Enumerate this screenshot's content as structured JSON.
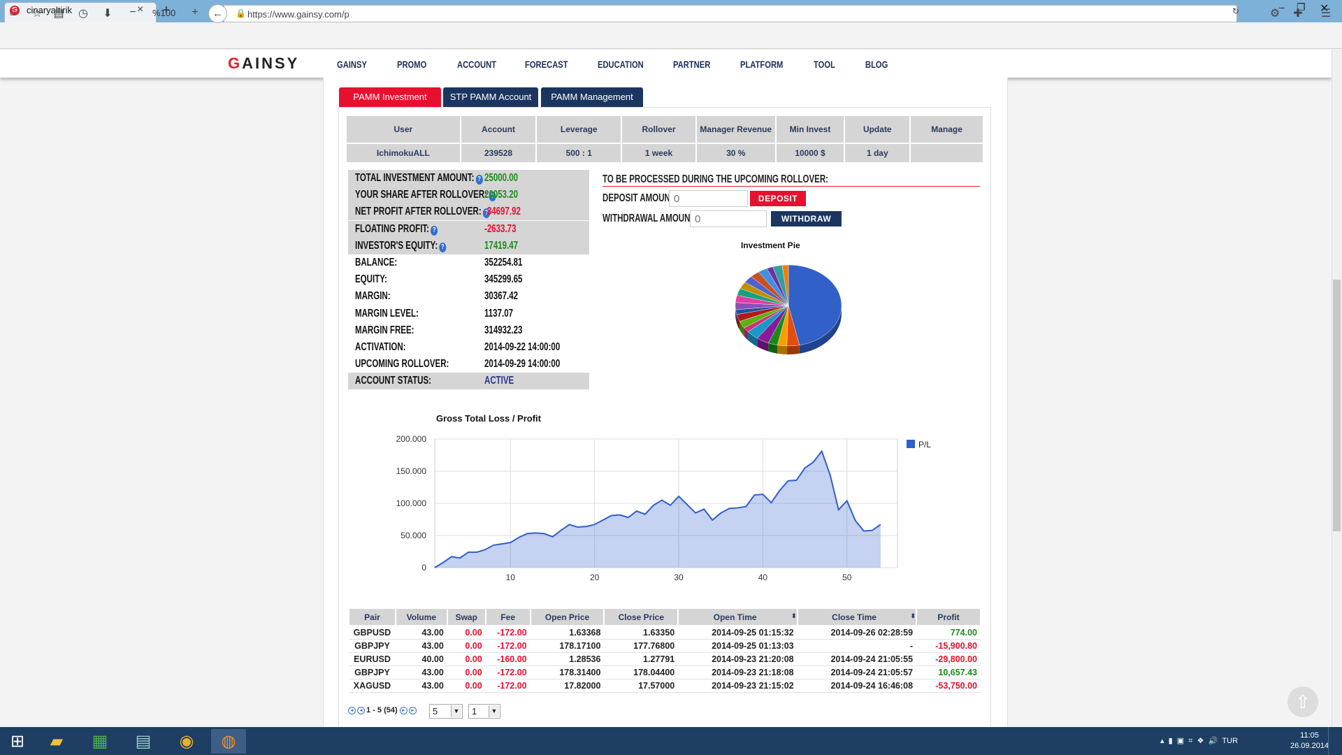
{
  "browser": {
    "tab_title": "cinaryaltirik",
    "zoom": "%100",
    "url": "https://www.gainsy.com/p"
  },
  "site": {
    "logo": "GAINSY",
    "logo_first": "G",
    "logo_rest": "AINSY",
    "nav": [
      "GAINSY",
      "PROMO",
      "ACCOUNT",
      "FORECAST",
      "EDUCATION",
      "PARTNER",
      "PLATFORM",
      "TOOL",
      "BLOG"
    ]
  },
  "tabs": [
    "PAMM Investment",
    "STP PAMM Account",
    "PAMM Management"
  ],
  "account_table": {
    "headers": [
      "User",
      "Account",
      "Leverage",
      "Rollover",
      "Manager Revenue",
      "Min Invest",
      "Update",
      "Manage"
    ],
    "row": [
      "IchimokuALL",
      "239528",
      "500 : 1",
      "1 week",
      "30 %",
      "10000 $",
      "1 day",
      ""
    ]
  },
  "stats": [
    {
      "label": "TOTAL INVESTMENT AMOUNT:",
      "value": "25000.00",
      "color": "#1a8a1a",
      "help": true
    },
    {
      "label": "YOUR SHARE AFTER ROLLOVER:",
      "value": "20053.20",
      "color": "#1a8a1a",
      "help": true
    },
    {
      "label": "NET PROFIT AFTER ROLLOVER:",
      "value": "-34697.92",
      "color": "#e3102f",
      "help": true
    },
    {
      "label": "FLOATING PROFIT:",
      "value": "-2633.73",
      "color": "#e3102f",
      "help": true
    },
    {
      "label": "INVESTOR'S EQUITY:",
      "value": "17419.47",
      "color": "#1a8a1a",
      "help": true
    },
    {
      "label": "BALANCE:",
      "value": "352254.81",
      "color": "#111",
      "help": false
    },
    {
      "label": "EQUITY:",
      "value": "345299.65",
      "color": "#111",
      "help": false
    },
    {
      "label": "MARGIN:",
      "value": "30367.42",
      "color": "#111",
      "help": false
    },
    {
      "label": "MARGIN LEVEL:",
      "value": "1137.07",
      "color": "#111",
      "help": false
    },
    {
      "label": "MARGIN FREE:",
      "value": "314932.23",
      "color": "#111",
      "help": false
    },
    {
      "label": "ACTIVATION:",
      "value": "2014-09-22 14:00:00",
      "color": "#111",
      "help": false
    },
    {
      "label": "UPCOMING ROLLOVER:",
      "value": "2014-09-29 14:00:00",
      "color": "#111",
      "help": false
    },
    {
      "label": "ACCOUNT STATUS:",
      "value": "ACTIVE",
      "color": "#2b3a8c",
      "help": false
    }
  ],
  "rollover": {
    "header": "TO BE PROCESSED DURING THE UPCOMING ROLLOVER:",
    "deposit_label": "DEPOSIT AMOUNT:",
    "deposit_placeholder": "0",
    "deposit_button": "DEPOSIT",
    "withdraw_label": "WITHDRAWAL AMOUNT:",
    "withdraw_placeholder": "0",
    "withdraw_button": "WITHDRAW"
  },
  "chart_data": [
    {
      "type": "pie",
      "title": "Investment Pie",
      "values": [
        49,
        4,
        3,
        3,
        4,
        4,
        2,
        3,
        3,
        2,
        3,
        3,
        3,
        3,
        3,
        3,
        3,
        2,
        3,
        2
      ],
      "colors": [
        "#3060c8",
        "#e24e10",
        "#f5a000",
        "#1a8a1a",
        "#8a1a9a",
        "#1a98c8",
        "#d0307a",
        "#60b010",
        "#b01a1a",
        "#2050a0",
        "#8a50b8",
        "#e040a0",
        "#18a080",
        "#c09000",
        "#5060d0",
        "#c85020",
        "#4090e0",
        "#7030a0",
        "#30a0a0",
        "#f08000"
      ]
    },
    {
      "type": "area",
      "title": "Gross Total Loss / Profit",
      "series": [
        {
          "name": "P/L",
          "values": [
            0,
            8000,
            17000,
            15000,
            24000,
            24000,
            28000,
            35000,
            37000,
            39000,
            47000,
            53000,
            54000,
            53000,
            48000,
            58000,
            67000,
            63000,
            64000,
            67000,
            74000,
            81000,
            82000,
            78000,
            88000,
            83000,
            97000,
            105000,
            97000,
            111000,
            98000,
            85000,
            91000,
            74000,
            85000,
            92000,
            93000,
            95000,
            113000,
            114000,
            101000,
            120000,
            135000,
            136000,
            155000,
            164000,
            181000,
            144000,
            90000,
            104000,
            73000,
            57000,
            58000,
            67000
          ]
        }
      ],
      "x": [
        1,
        2,
        3,
        4,
        5,
        6,
        7,
        8,
        9,
        10,
        11,
        12,
        13,
        14,
        15,
        16,
        17,
        18,
        19,
        20,
        21,
        22,
        23,
        24,
        25,
        26,
        27,
        28,
        29,
        30,
        31,
        32,
        33,
        34,
        35,
        36,
        37,
        38,
        39,
        40,
        41,
        42,
        43,
        44,
        45,
        46,
        47,
        48,
        49,
        50,
        51,
        52,
        53,
        54
      ],
      "yticks": [
        "200.000",
        "150.000",
        "100.000",
        "50.000",
        "0"
      ],
      "xticks": [
        "10",
        "20",
        "30",
        "40",
        "50"
      ],
      "ylim": [
        0,
        200000
      ],
      "xlim": [
        1,
        56
      ],
      "legend": "top-right",
      "color": "#2f5fcc"
    }
  ],
  "trades": {
    "headers": [
      "Pair",
      "Volume",
      "Swap",
      "Fee",
      "Open Price",
      "Close Price",
      "Open Time",
      "Close Time",
      "Profit"
    ],
    "rows": [
      [
        "GBPUSD",
        "43.00",
        "0.00",
        "-172.00",
        "1.63368",
        "1.63350",
        "2014-09-25 01:15:32",
        "2014-09-26 02:28:59",
        "774.00"
      ],
      [
        "GBPJPY",
        "43.00",
        "0.00",
        "-172.00",
        "178.17100",
        "177.76800",
        "2014-09-25 01:13:03",
        "-",
        "-15,900.80"
      ],
      [
        "EURUSD",
        "40.00",
        "0.00",
        "-160.00",
        "1.28536",
        "1.27791",
        "2014-09-23 21:20:08",
        "2014-09-24 21:05:55",
        "-29,800.00"
      ],
      [
        "GBPJPY",
        "43.00",
        "0.00",
        "-172.00",
        "178.31400",
        "178.04400",
        "2014-09-23 21:18:08",
        "2014-09-24 21:05:57",
        "10,657.43"
      ],
      [
        "XAGUSD",
        "43.00",
        "0.00",
        "-172.00",
        "17.82000",
        "17.57000",
        "2014-09-23 21:15:02",
        "2014-09-24 16:46:08",
        "-53,750.00"
      ]
    ]
  },
  "pager": {
    "range": "1 - 5 (54)",
    "page_size": "5",
    "page": "1"
  },
  "taskbar": {
    "lang": "TUR",
    "time": "11:05",
    "date": "26.09.2014"
  }
}
